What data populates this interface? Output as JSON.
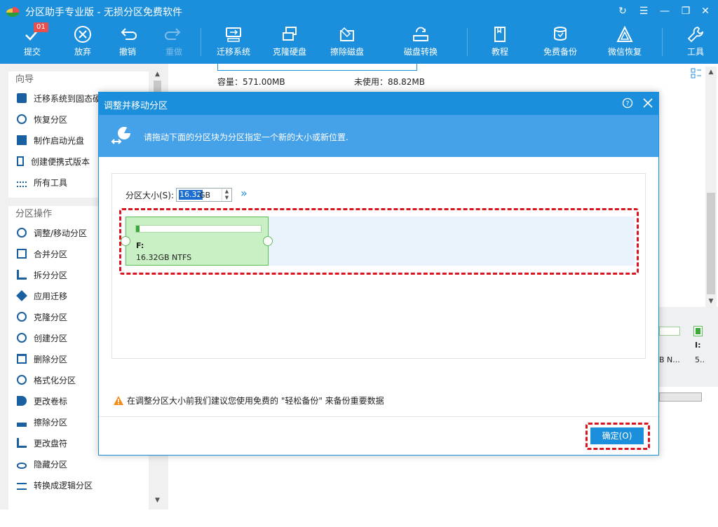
{
  "app": {
    "title": "分区助手专业版 - 无损分区免费软件"
  },
  "colors": {
    "accent": "#1c8fdc",
    "highlight": "#d9141e",
    "partition_fill": "#c9efc4"
  },
  "toolbar": {
    "commit": {
      "label": "提交",
      "badge": "01"
    },
    "discard": {
      "label": "放弃"
    },
    "undo": {
      "label": "撤销"
    },
    "redo": {
      "label": "重做"
    },
    "migrate": {
      "label": "迁移系统"
    },
    "clone_disk": {
      "label": "克隆硬盘"
    },
    "wipe_disk": {
      "label": "擦除磁盘"
    },
    "convert_disk": {
      "label": "磁盘转换"
    },
    "tutorial": {
      "label": "教程"
    },
    "free_backup": {
      "label": "免费备份"
    },
    "wechat_recovery": {
      "label": "微信恢复"
    },
    "tools": {
      "label": "工具"
    }
  },
  "sidebar": {
    "wizard_title": "向导",
    "wizard_items": [
      {
        "label": "迁移系统到固态硬盘",
        "icon": "migrate-ssd-icon"
      },
      {
        "label": "恢复分区",
        "icon": "recover-partition-icon"
      },
      {
        "label": "制作启动光盘",
        "icon": "boot-disc-icon"
      },
      {
        "label": "创建便携式版本",
        "icon": "portable-icon"
      },
      {
        "label": "所有工具",
        "icon": "all-tools-icon"
      }
    ],
    "ops_title": "分区操作",
    "ops_items": [
      {
        "label": "调整/移动分区",
        "icon": "resize-icon"
      },
      {
        "label": "合并分区",
        "icon": "merge-icon"
      },
      {
        "label": "拆分分区",
        "icon": "split-icon"
      },
      {
        "label": "应用迁移",
        "icon": "app-migrate-icon"
      },
      {
        "label": "克隆分区",
        "icon": "clone-icon"
      },
      {
        "label": "创建分区",
        "icon": "create-icon"
      },
      {
        "label": "删除分区",
        "icon": "delete-icon"
      },
      {
        "label": "格式化分区",
        "icon": "format-icon"
      },
      {
        "label": "更改卷标",
        "icon": "label-icon"
      },
      {
        "label": "擦除分区",
        "icon": "wipe-icon"
      },
      {
        "label": "更改盘符",
        "icon": "drive-letter-icon"
      },
      {
        "label": "隐藏分区",
        "icon": "hide-icon"
      },
      {
        "label": "转换成逻辑分区",
        "icon": "convert-logical-icon"
      }
    ]
  },
  "main": {
    "capacity": "容量：571.00MB",
    "unused": "未使用：88.82MB",
    "right_labels": {
      "bn": "B N...",
      "five": "5..",
      "i_label": "I:"
    }
  },
  "dialog": {
    "title": "调整并移动分区",
    "banner_text": "请拖动下面的分区块为分区指定一个新的大小或新位置.",
    "size_label": "分区大小(S):",
    "size_value": "16.32",
    "size_unit": "GB",
    "partition": {
      "name": "F:",
      "info": "16.32GB NTFS",
      "used_fraction": 0.03
    },
    "warning": "在调整分区大小前我们建议您使用免费的 \"轻松备份\" 来备份重要数据",
    "ok_label": "确定(O)"
  }
}
